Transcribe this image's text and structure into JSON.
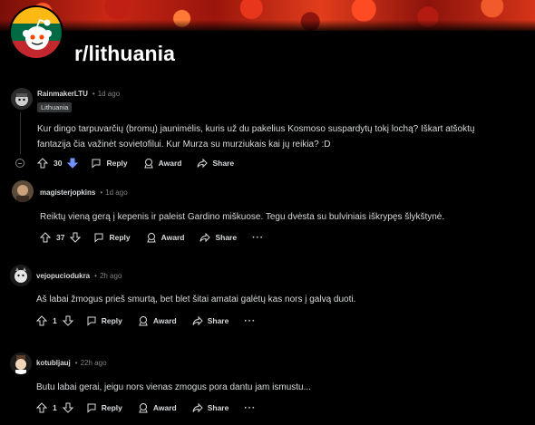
{
  "subreddit": {
    "name": "r/lithuania"
  },
  "comments": [
    {
      "author": "RainmakerLTU",
      "time": "1d ago",
      "flair": "Lithuania",
      "text_line1": "Kur dingo tarpuvarčių (bromų) jaunimėlis, kuris už du pakelius Kosmoso suspardytų tokį lochą? Iškart atšoktų",
      "text_line2": "fantazija čia važinėt sovietofilui. Kur Murza su murziukais kai jų reikia? :D",
      "votes": "30",
      "upvote_state": "downvoted",
      "reply_label": "Reply",
      "award_label": "Award",
      "share_label": "Share"
    },
    {
      "author": "magisterjopkins",
      "time": "1d ago",
      "text_line1": "Reiktų vieną gerą į kepenis ir paleist Gardino miškuose. Tegu dvėsta su bulviniais iškrypęs šlykštynė.",
      "votes": "37",
      "reply_label": "Reply",
      "award_label": "Award",
      "share_label": "Share"
    },
    {
      "author": "vejopuciodukra",
      "time": "2h ago",
      "text_line1": "Aš labai žmogus prieš smurtą, bet blet šitai amatai galėtų kas nors į galvą duoti.",
      "votes": "1",
      "reply_label": "Reply",
      "award_label": "Award",
      "share_label": "Share"
    },
    {
      "author": "kotubljauj",
      "time": "22h ago",
      "text_line1": "Butu labai gerai, jeigu nors vienas zmogus pora dantu jam ismustu...",
      "votes": "1",
      "reply_label": "Reply",
      "award_label": "Award",
      "share_label": "Share"
    }
  ],
  "colors": {
    "downvote_active": "#7193ff",
    "flag_yellow": "#fdb913",
    "flag_green": "#006a44",
    "flag_red": "#c1272d"
  },
  "icons": [
    "snoo-icon",
    "upvote-icon",
    "downvote-icon",
    "reply-icon",
    "award-icon",
    "share-icon",
    "more-icon",
    "collapse-icon"
  ]
}
